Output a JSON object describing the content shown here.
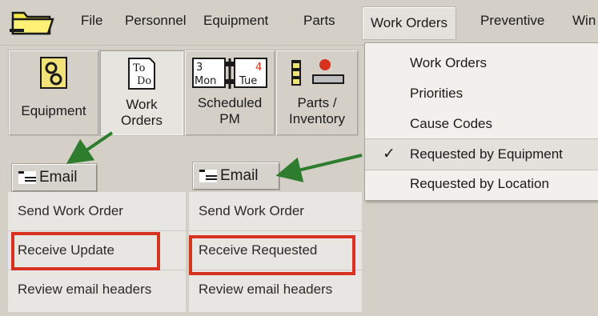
{
  "menubar": {
    "items": [
      "File",
      "Personnel",
      "Equipment",
      "Parts",
      "Work Orders",
      "Preventive",
      "Win"
    ],
    "active_item": "Work Orders"
  },
  "toolbar": {
    "equipment": "Equipment",
    "work_orders": "Work\nOrders",
    "scheduled_pm": "Scheduled\nPM",
    "parts_inventory": "Parts /\nInventory",
    "calendar_icon": {
      "left_day": "3",
      "left_label": "Mon",
      "right_day": "4",
      "right_label": "Tue"
    },
    "todo_icon": {
      "line1": "To",
      "line2": "Do"
    }
  },
  "email_panels": [
    {
      "button_label": "Email",
      "items": [
        "Send Work Order",
        "Receive Update",
        "Review email headers"
      ],
      "highlighted": "Receive Update"
    },
    {
      "button_label": "Email",
      "items": [
        "Send Work Order",
        "Receive Requested",
        "Review email headers"
      ],
      "highlighted": "Receive Requested"
    }
  ],
  "dropdown": {
    "items": [
      "Work Orders",
      "Priorities",
      "Cause Codes",
      "Requested by Equipment",
      "Requested by Location"
    ],
    "checked_item": "Requested by Equipment",
    "check_mark": "✓"
  },
  "colors": {
    "highlight_border": "#d7321f",
    "arrow_green": "#2e7d2e",
    "chrome": "#d4d0c8"
  },
  "icons": [
    "folder-icon",
    "gears-icon",
    "todo-icon",
    "calendar-icon",
    "parts-icon",
    "email-icon",
    "check-icon"
  ]
}
